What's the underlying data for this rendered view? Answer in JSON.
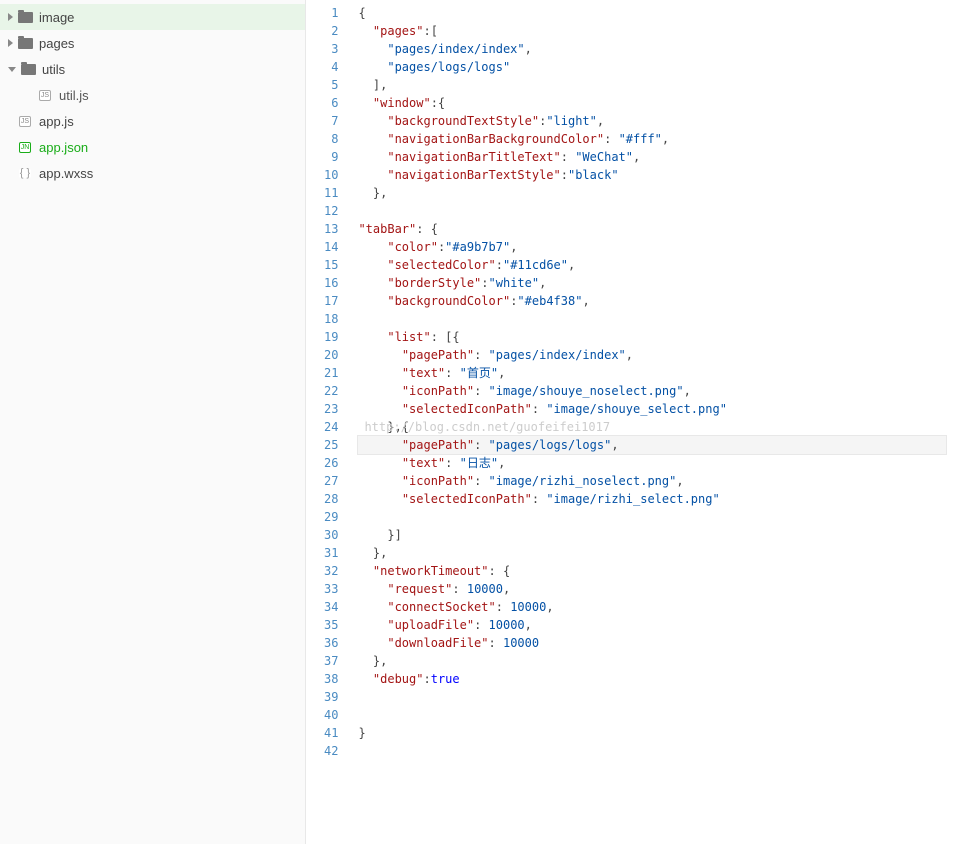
{
  "tree": {
    "image": "image",
    "pages": "pages",
    "utils": "utils",
    "utiljs": "util.js",
    "appjs": "app.js",
    "appjson": "app.json",
    "appwxss": "app.wxss",
    "badge_js": "JS",
    "badge_jn": "JN",
    "badge_curly": "{ }"
  },
  "code": [
    {
      "ind": 0,
      "tokens": [
        {
          "t": "{",
          "c": "p"
        }
      ]
    },
    {
      "ind": 1,
      "tokens": [
        {
          "t": "\"pages\"",
          "c": "k"
        },
        {
          "t": ":[",
          "c": "p"
        }
      ]
    },
    {
      "ind": 2,
      "tokens": [
        {
          "t": "\"pages/index/index\"",
          "c": "s"
        },
        {
          "t": ",",
          "c": "p"
        }
      ]
    },
    {
      "ind": 2,
      "tokens": [
        {
          "t": "\"pages/logs/logs\"",
          "c": "s"
        }
      ]
    },
    {
      "ind": 1,
      "tokens": [
        {
          "t": "],",
          "c": "p"
        }
      ]
    },
    {
      "ind": 1,
      "tokens": [
        {
          "t": "\"window\"",
          "c": "k"
        },
        {
          "t": ":{",
          "c": "p"
        }
      ]
    },
    {
      "ind": 2,
      "tokens": [
        {
          "t": "\"backgroundTextStyle\"",
          "c": "k"
        },
        {
          "t": ":",
          "c": "p"
        },
        {
          "t": "\"light\"",
          "c": "s"
        },
        {
          "t": ",",
          "c": "p"
        }
      ]
    },
    {
      "ind": 2,
      "tokens": [
        {
          "t": "\"navigationBarBackgroundColor\"",
          "c": "k"
        },
        {
          "t": ": ",
          "c": "p"
        },
        {
          "t": "\"#fff\"",
          "c": "s"
        },
        {
          "t": ",",
          "c": "p"
        }
      ]
    },
    {
      "ind": 2,
      "tokens": [
        {
          "t": "\"navigationBarTitleText\"",
          "c": "k"
        },
        {
          "t": ": ",
          "c": "p"
        },
        {
          "t": "\"WeChat\"",
          "c": "s"
        },
        {
          "t": ",",
          "c": "p"
        }
      ]
    },
    {
      "ind": 2,
      "tokens": [
        {
          "t": "\"navigationBarTextStyle\"",
          "c": "k"
        },
        {
          "t": ":",
          "c": "p"
        },
        {
          "t": "\"black\"",
          "c": "s"
        }
      ]
    },
    {
      "ind": 1,
      "tokens": [
        {
          "t": "},",
          "c": "p"
        }
      ]
    },
    {
      "ind": 0,
      "tokens": []
    },
    {
      "ind": 0,
      "tokens": [
        {
          "t": "\"tabBar\"",
          "c": "k"
        },
        {
          "t": ": {",
          "c": "p"
        }
      ]
    },
    {
      "ind": 2,
      "tokens": [
        {
          "t": "\"color\"",
          "c": "k"
        },
        {
          "t": ":",
          "c": "p"
        },
        {
          "t": "\"#a9b7b7\"",
          "c": "s"
        },
        {
          "t": ",",
          "c": "p"
        }
      ]
    },
    {
      "ind": 2,
      "tokens": [
        {
          "t": "\"selectedColor\"",
          "c": "k"
        },
        {
          "t": ":",
          "c": "p"
        },
        {
          "t": "\"#11cd6e\"",
          "c": "s"
        },
        {
          "t": ",",
          "c": "p"
        }
      ]
    },
    {
      "ind": 2,
      "tokens": [
        {
          "t": "\"borderStyle\"",
          "c": "k"
        },
        {
          "t": ":",
          "c": "p"
        },
        {
          "t": "\"white\"",
          "c": "s"
        },
        {
          "t": ",",
          "c": "p"
        }
      ]
    },
    {
      "ind": 2,
      "tokens": [
        {
          "t": "\"backgroundColor\"",
          "c": "k"
        },
        {
          "t": ":",
          "c": "p"
        },
        {
          "t": "\"#eb4f38\"",
          "c": "s"
        },
        {
          "t": ",",
          "c": "p"
        }
      ]
    },
    {
      "ind": 0,
      "tokens": []
    },
    {
      "ind": 2,
      "tokens": [
        {
          "t": "\"list\"",
          "c": "k"
        },
        {
          "t": ": [{",
          "c": "p"
        }
      ]
    },
    {
      "ind": 3,
      "tokens": [
        {
          "t": "\"pagePath\"",
          "c": "k"
        },
        {
          "t": ": ",
          "c": "p"
        },
        {
          "t": "\"pages/index/index\"",
          "c": "s"
        },
        {
          "t": ",",
          "c": "p"
        }
      ]
    },
    {
      "ind": 3,
      "tokens": [
        {
          "t": "\"text\"",
          "c": "k"
        },
        {
          "t": ": ",
          "c": "p"
        },
        {
          "t": "\"首页\"",
          "c": "s"
        },
        {
          "t": ",",
          "c": "p"
        }
      ]
    },
    {
      "ind": 3,
      "tokens": [
        {
          "t": "\"iconPath\"",
          "c": "k"
        },
        {
          "t": ": ",
          "c": "p"
        },
        {
          "t": "\"image/shouye_noselect.png\"",
          "c": "s"
        },
        {
          "t": ",",
          "c": "p"
        }
      ]
    },
    {
      "ind": 3,
      "tokens": [
        {
          "t": "\"selectedIconPath\"",
          "c": "k"
        },
        {
          "t": ": ",
          "c": "p"
        },
        {
          "t": "\"image/shouye_select.png\"",
          "c": "s"
        }
      ]
    },
    {
      "ind": 2,
      "tokens": [
        {
          "t": "},{",
          "c": "p"
        }
      ],
      "watermark": "http://blog.csdn.net/guofeifei1017"
    },
    {
      "ind": 3,
      "tokens": [
        {
          "t": "\"pagePath\"",
          "c": "k"
        },
        {
          "t": ": ",
          "c": "p"
        },
        {
          "t": "\"pages/logs/logs\"",
          "c": "s"
        },
        {
          "t": ",",
          "c": "p"
        }
      ],
      "hl": true
    },
    {
      "ind": 3,
      "tokens": [
        {
          "t": "\"text\"",
          "c": "k"
        },
        {
          "t": ": ",
          "c": "p"
        },
        {
          "t": "\"日志\"",
          "c": "s"
        },
        {
          "t": ",",
          "c": "p"
        }
      ]
    },
    {
      "ind": 3,
      "tokens": [
        {
          "t": "\"iconPath\"",
          "c": "k"
        },
        {
          "t": ": ",
          "c": "p"
        },
        {
          "t": "\"image/rizhi_noselect.png\"",
          "c": "s"
        },
        {
          "t": ",",
          "c": "p"
        }
      ]
    },
    {
      "ind": 3,
      "tokens": [
        {
          "t": "\"selectedIconPath\"",
          "c": "k"
        },
        {
          "t": ": ",
          "c": "p"
        },
        {
          "t": "\"image/rizhi_select.png\"",
          "c": "s"
        }
      ]
    },
    {
      "ind": 0,
      "tokens": []
    },
    {
      "ind": 2,
      "tokens": [
        {
          "t": "}]",
          "c": "p"
        }
      ]
    },
    {
      "ind": 1,
      "tokens": [
        {
          "t": "},",
          "c": "p"
        }
      ]
    },
    {
      "ind": 1,
      "tokens": [
        {
          "t": "\"networkTimeout\"",
          "c": "k"
        },
        {
          "t": ": {",
          "c": "p"
        }
      ]
    },
    {
      "ind": 2,
      "tokens": [
        {
          "t": "\"request\"",
          "c": "k"
        },
        {
          "t": ": ",
          "c": "p"
        },
        {
          "t": "10000",
          "c": "n"
        },
        {
          "t": ",",
          "c": "p"
        }
      ]
    },
    {
      "ind": 2,
      "tokens": [
        {
          "t": "\"connectSocket\"",
          "c": "k"
        },
        {
          "t": ": ",
          "c": "p"
        },
        {
          "t": "10000",
          "c": "n"
        },
        {
          "t": ",",
          "c": "p"
        }
      ]
    },
    {
      "ind": 2,
      "tokens": [
        {
          "t": "\"uploadFile\"",
          "c": "k"
        },
        {
          "t": ": ",
          "c": "p"
        },
        {
          "t": "10000",
          "c": "n"
        },
        {
          "t": ",",
          "c": "p"
        }
      ]
    },
    {
      "ind": 2,
      "tokens": [
        {
          "t": "\"downloadFile\"",
          "c": "k"
        },
        {
          "t": ": ",
          "c": "p"
        },
        {
          "t": "10000",
          "c": "n"
        }
      ]
    },
    {
      "ind": 1,
      "tokens": [
        {
          "t": "},",
          "c": "p"
        }
      ]
    },
    {
      "ind": 1,
      "tokens": [
        {
          "t": "\"debug\"",
          "c": "k"
        },
        {
          "t": ":",
          "c": "p"
        },
        {
          "t": "true",
          "c": "b"
        }
      ]
    },
    {
      "ind": 0,
      "tokens": []
    },
    {
      "ind": 0,
      "tokens": []
    },
    {
      "ind": 0,
      "tokens": [
        {
          "t": "}",
          "c": "p"
        }
      ]
    },
    {
      "ind": 0,
      "tokens": []
    }
  ]
}
